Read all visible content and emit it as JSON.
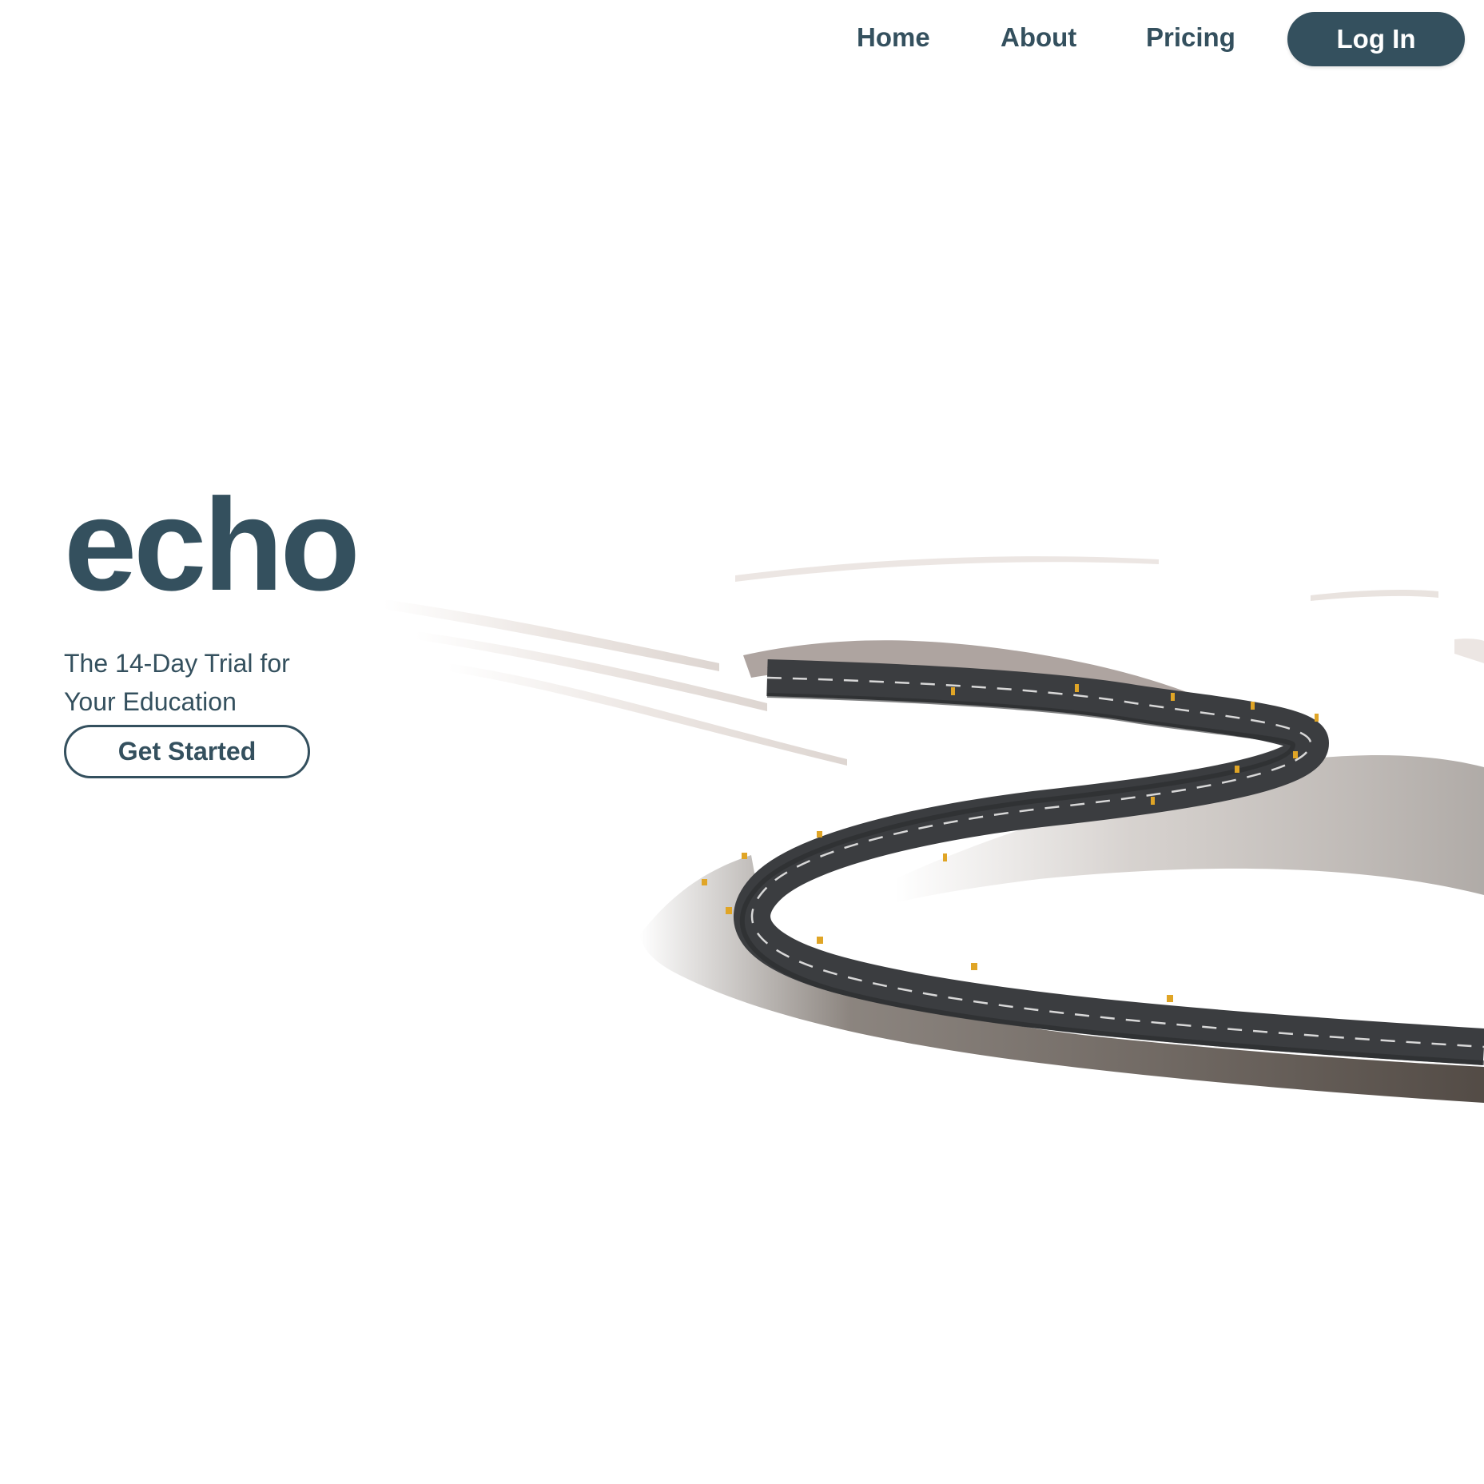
{
  "nav": {
    "home_label": "Home",
    "about_label": "About",
    "pricing_label": "Pricing",
    "login_label": "Log In"
  },
  "hero": {
    "brand": "echo",
    "tagline_line1": "The 14-Day Trial for",
    "tagline_line2": "Your Education",
    "cta_label": "Get Started"
  },
  "colors": {
    "primary": "#34505e",
    "background": "#ffffff",
    "road": "#3b3d40",
    "earth": "#5a5048"
  }
}
